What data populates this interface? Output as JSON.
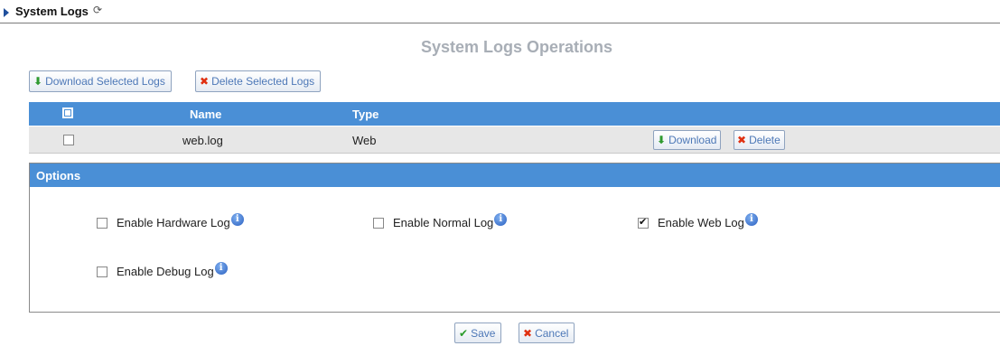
{
  "header": {
    "title": "System Logs",
    "refresh_glyph": "⟳"
  },
  "section_title": "System Logs Operations",
  "toolbar": {
    "download_selected_label": "Download Selected Logs",
    "delete_selected_label": "Delete Selected Logs"
  },
  "table": {
    "columns": [
      "Name",
      "Type"
    ],
    "rows": [
      {
        "name": "web.log",
        "type": "Web",
        "download_label": "Download",
        "delete_label": "Delete",
        "checked": false
      }
    ]
  },
  "options": {
    "title": "Options",
    "items": [
      {
        "label": "Enable Hardware Log",
        "checked": false
      },
      {
        "label": "Enable Normal Log",
        "checked": false
      },
      {
        "label": "Enable Web Log",
        "checked": true
      },
      {
        "label": "Enable Debug Log",
        "checked": false
      }
    ]
  },
  "footer": {
    "save_label": "Save",
    "cancel_label": "Cancel"
  },
  "colors": {
    "accent": "#4a8fd6",
    "button_text": "#4d78b7",
    "title_gray": "#a8aeb6"
  },
  "icons": {
    "info": "info-icon",
    "download": "download-arrow-icon",
    "delete": "x-icon",
    "save": "checkmark-icon"
  }
}
